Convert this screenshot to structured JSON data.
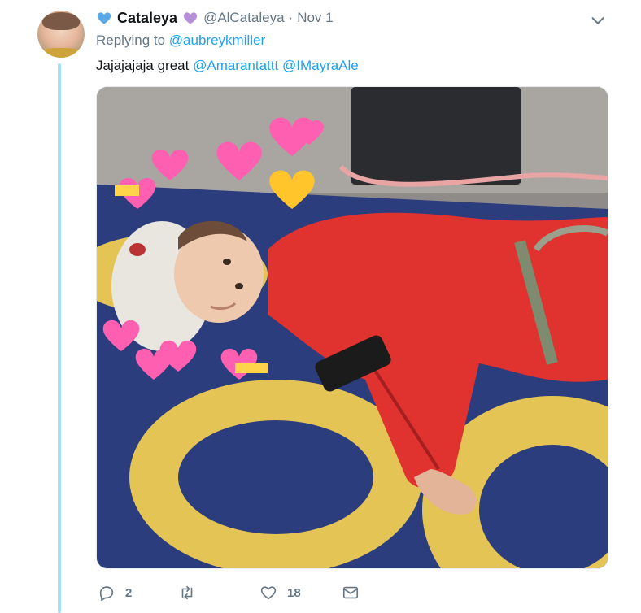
{
  "tweet": {
    "display_name": "Cataleya",
    "handle": "@AlCataleya",
    "separator": "·",
    "date": "Nov 1",
    "name_emoji_left": "blue-heart",
    "name_emoji_right": "purple-heart",
    "replying_to_prefix": "Replying to",
    "replying_to_user": "@aubreykmiller",
    "text_prefix": "Jajajajaja great",
    "mentions": [
      "@Amarantattt",
      "@IMayraAle"
    ],
    "media": {
      "type": "photo",
      "icon": "photo-icon"
    }
  },
  "actions": {
    "reply_count": "2",
    "retweet_count": "",
    "like_count": "18"
  },
  "colors": {
    "link": "#1da1f2",
    "muted": "#657786",
    "thread_line": "#a7dff6",
    "blue_heart": "#5aa8e6",
    "purple_heart": "#b68fd9"
  }
}
